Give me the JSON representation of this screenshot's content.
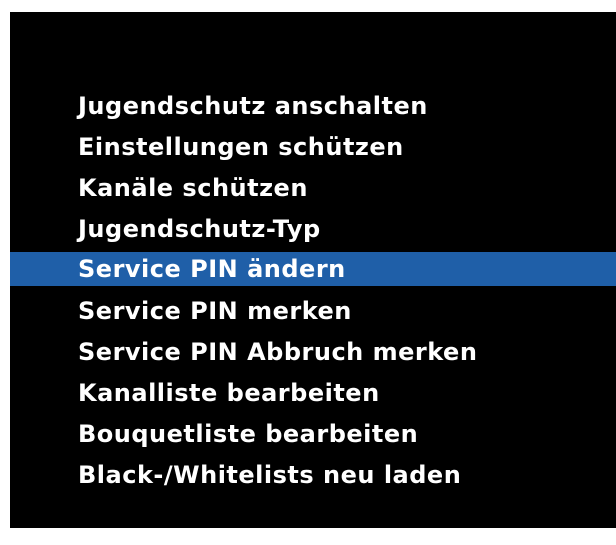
{
  "menu": {
    "selected_index": 4,
    "items": [
      {
        "label": "Jugendschutz anschalten"
      },
      {
        "label": "Einstellungen schützen"
      },
      {
        "label": "Kanäle schützen"
      },
      {
        "label": "Jugendschutz-Typ"
      },
      {
        "label": "Service PIN ändern"
      },
      {
        "label": "Service PIN merken"
      },
      {
        "label": "Service PIN Abbruch merken"
      },
      {
        "label": "Kanalliste bearbeiten"
      },
      {
        "label": "Bouquetliste bearbeiten"
      },
      {
        "label": "Black-/Whitelists neu laden"
      }
    ]
  },
  "colors": {
    "background": "#000000",
    "text": "#ffffff",
    "selection_highlight": "#1f5fa8"
  }
}
